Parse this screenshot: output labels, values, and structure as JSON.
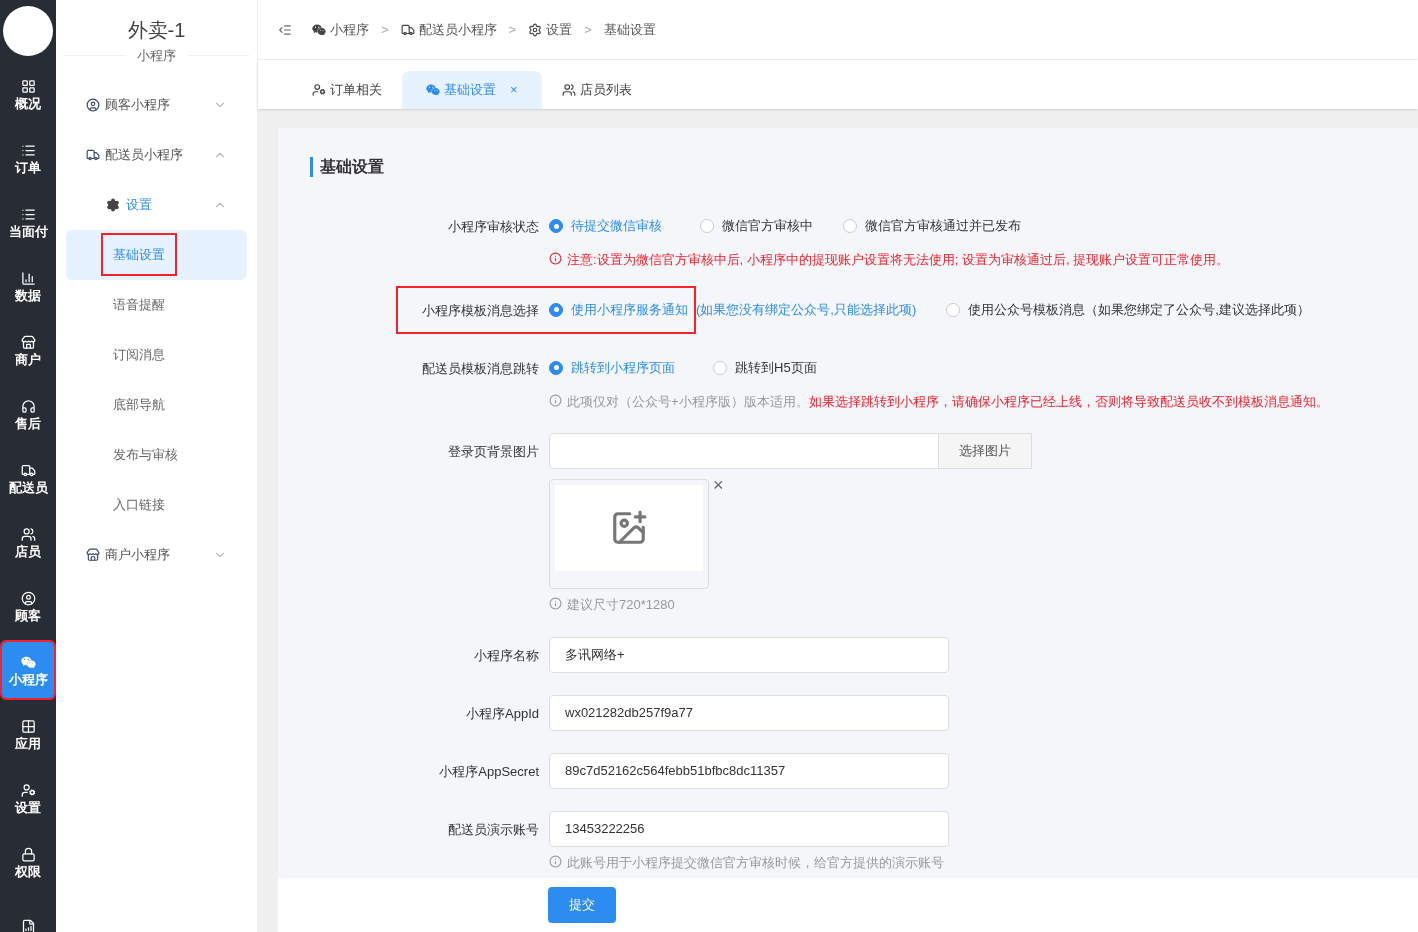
{
  "nav": {
    "items": [
      {
        "label": "概况",
        "selected": false,
        "annotated": false
      },
      {
        "label": "订单",
        "selected": false,
        "annotated": false
      },
      {
        "label": "当面付",
        "selected": false,
        "annotated": false
      },
      {
        "label": "数据",
        "selected": false,
        "annotated": false
      },
      {
        "label": "商户",
        "selected": false,
        "annotated": false
      },
      {
        "label": "售后",
        "selected": false,
        "annotated": false
      },
      {
        "label": "配送员",
        "selected": false,
        "annotated": false
      },
      {
        "label": "店员",
        "selected": false,
        "annotated": false
      },
      {
        "label": "顾客",
        "selected": false,
        "annotated": false
      },
      {
        "label": "小程序",
        "selected": true,
        "annotated": true
      },
      {
        "label": "应用",
        "selected": false,
        "annotated": false
      },
      {
        "label": "设置",
        "selected": false,
        "annotated": false
      },
      {
        "label": "权限",
        "selected": false,
        "annotated": false
      },
      {
        "selected": false,
        "annotated": false
      }
    ]
  },
  "menu": {
    "title": "外卖-1",
    "subtitle": "小程序",
    "items": [
      {
        "label": "顾客小程序",
        "expanded": false
      },
      {
        "label": "配送员小程序",
        "expanded": true,
        "children": [
          {
            "label": "设置",
            "expanded": true,
            "children": [
              {
                "label": "基础设置",
                "selected": true,
                "annotated": true
              },
              {
                "label": "语音提醒",
                "selected": false,
                "annotated": false
              },
              {
                "label": "订阅消息",
                "selected": false,
                "annotated": false
              },
              {
                "label": "底部导航",
                "selected": false,
                "annotated": false
              },
              {
                "label": "发布与审核",
                "selected": false,
                "annotated": false
              },
              {
                "label": "入口链接",
                "selected": false,
                "annotated": false
              }
            ]
          }
        ]
      },
      {
        "label": "商户小程序",
        "expanded": false
      }
    ]
  },
  "breadcrumb": [
    "小程序",
    "配送员小程序",
    "设置",
    "基础设置"
  ],
  "breadcrumb_separator": ">",
  "tabs": [
    {
      "label": "订单相关",
      "selected": false
    },
    {
      "label": "基础设置",
      "selected": true,
      "close": "×"
    },
    {
      "label": "店员列表",
      "selected": false
    }
  ],
  "card": {
    "title": "基础设置",
    "rows": [
      {
        "kind": "radio",
        "label": "小程序审核状态",
        "annotated": false,
        "options": [
          {
            "label": "待提交微信审核",
            "selected": true
          },
          {
            "label": "微信官方审核中",
            "selected": false
          },
          {
            "label": "微信官方审核通过并已发布",
            "selected": false
          }
        ]
      },
      {
        "kind": "warning",
        "text": "注意:设置为微信官方审核中后, 小程序中的提现账户设置将无法使用; 设置为审核通过后, 提现账户设置可正常使用。"
      },
      {
        "kind": "radio",
        "label": "小程序模板消息选择",
        "annotated": true,
        "options": [
          {
            "label": "使用小程序服务通知",
            "hint": "(如果您没有绑定公众号,只能选择此项)",
            "selected": true
          },
          {
            "label": "使用公众号模板消息（如果您绑定了公众号,建议选择此项）",
            "selected": false
          }
        ]
      },
      {
        "kind": "radio",
        "label": "配送员模板消息跳转",
        "annotated": false,
        "options": [
          {
            "label": "跳转到小程序页面",
            "selected": true
          },
          {
            "label": "跳转到H5页面",
            "selected": false
          }
        ]
      },
      {
        "kind": "note",
        "text": "此项仅对（公众号+小程序版）版本适用。",
        "emphasis": "如果选择跳转到小程序，请确保小程序已经上线，否则将导致配送员收不到模板消息通知。"
      },
      {
        "kind": "image",
        "label": "登录页背景图片",
        "button": "选择图片",
        "remove": "×"
      },
      {
        "kind": "note",
        "text": "建议尺寸720*1280"
      },
      {
        "kind": "input",
        "label": "小程序名称",
        "value": "多讯网络+"
      },
      {
        "kind": "input",
        "label": "小程序AppId",
        "value": "wx021282db257f9a77"
      },
      {
        "kind": "input",
        "label": "小程序AppSecret",
        "value": "89c7d52162c564febb51bfbc8dc11357"
      },
      {
        "kind": "input",
        "label": "配送员演示账号",
        "value": "13453222256"
      },
      {
        "kind": "note",
        "text": "此账号用于小程序提交微信官方审核时候，给官方提供的演示账号"
      }
    ]
  },
  "submit": "提交"
}
